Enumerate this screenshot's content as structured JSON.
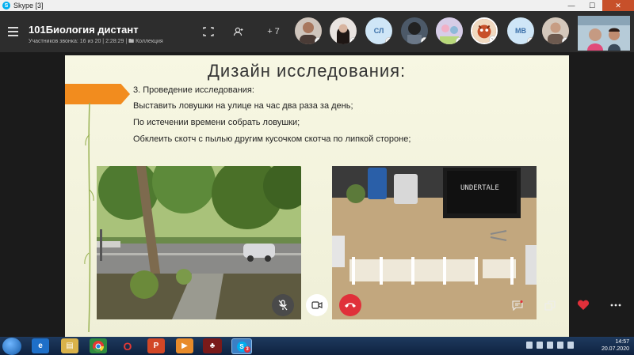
{
  "window": {
    "title": "Skype [3]",
    "minimize": "—",
    "maximize": "☐",
    "close": "✕"
  },
  "call": {
    "title": "101Биология дистант",
    "subtitle": "Участников звонка: 16 из 20 | 2:28:29 | 🖿 Коллекция",
    "add_people_label": "+ 7",
    "participants": [
      {
        "initials": "",
        "color": "#7a5a48"
      },
      {
        "initials": "",
        "color": "#3b2a26"
      },
      {
        "initials": "СЛ",
        "color": "#cfe6f7"
      },
      {
        "initials": "",
        "color": "#2a3a4a"
      },
      {
        "initials": "",
        "color": "#b0a0c8"
      },
      {
        "initials": "",
        "color": "#c8502a"
      },
      {
        "initials": "МВ",
        "color": "#cfe6f7"
      },
      {
        "initials": "",
        "color": "#a08070"
      }
    ]
  },
  "slide": {
    "title": "Дизайн исследования:",
    "lines": [
      "3. Проведение исследования:",
      "Выставить ловушки на улице на час два раза за день;",
      "По истечении времени собрать ловушки;",
      "Обклеить скотч с пылью другим кусочком скотча по липкой стороне;"
    ],
    "accent_color": "#f28c1e",
    "photo_right_screen_text": "UNDERTALE"
  },
  "controls": {
    "end_color": "#e0303a"
  },
  "taskbar": {
    "time": "14:57",
    "date": "20.07.2020",
    "skype_badge": "3"
  }
}
